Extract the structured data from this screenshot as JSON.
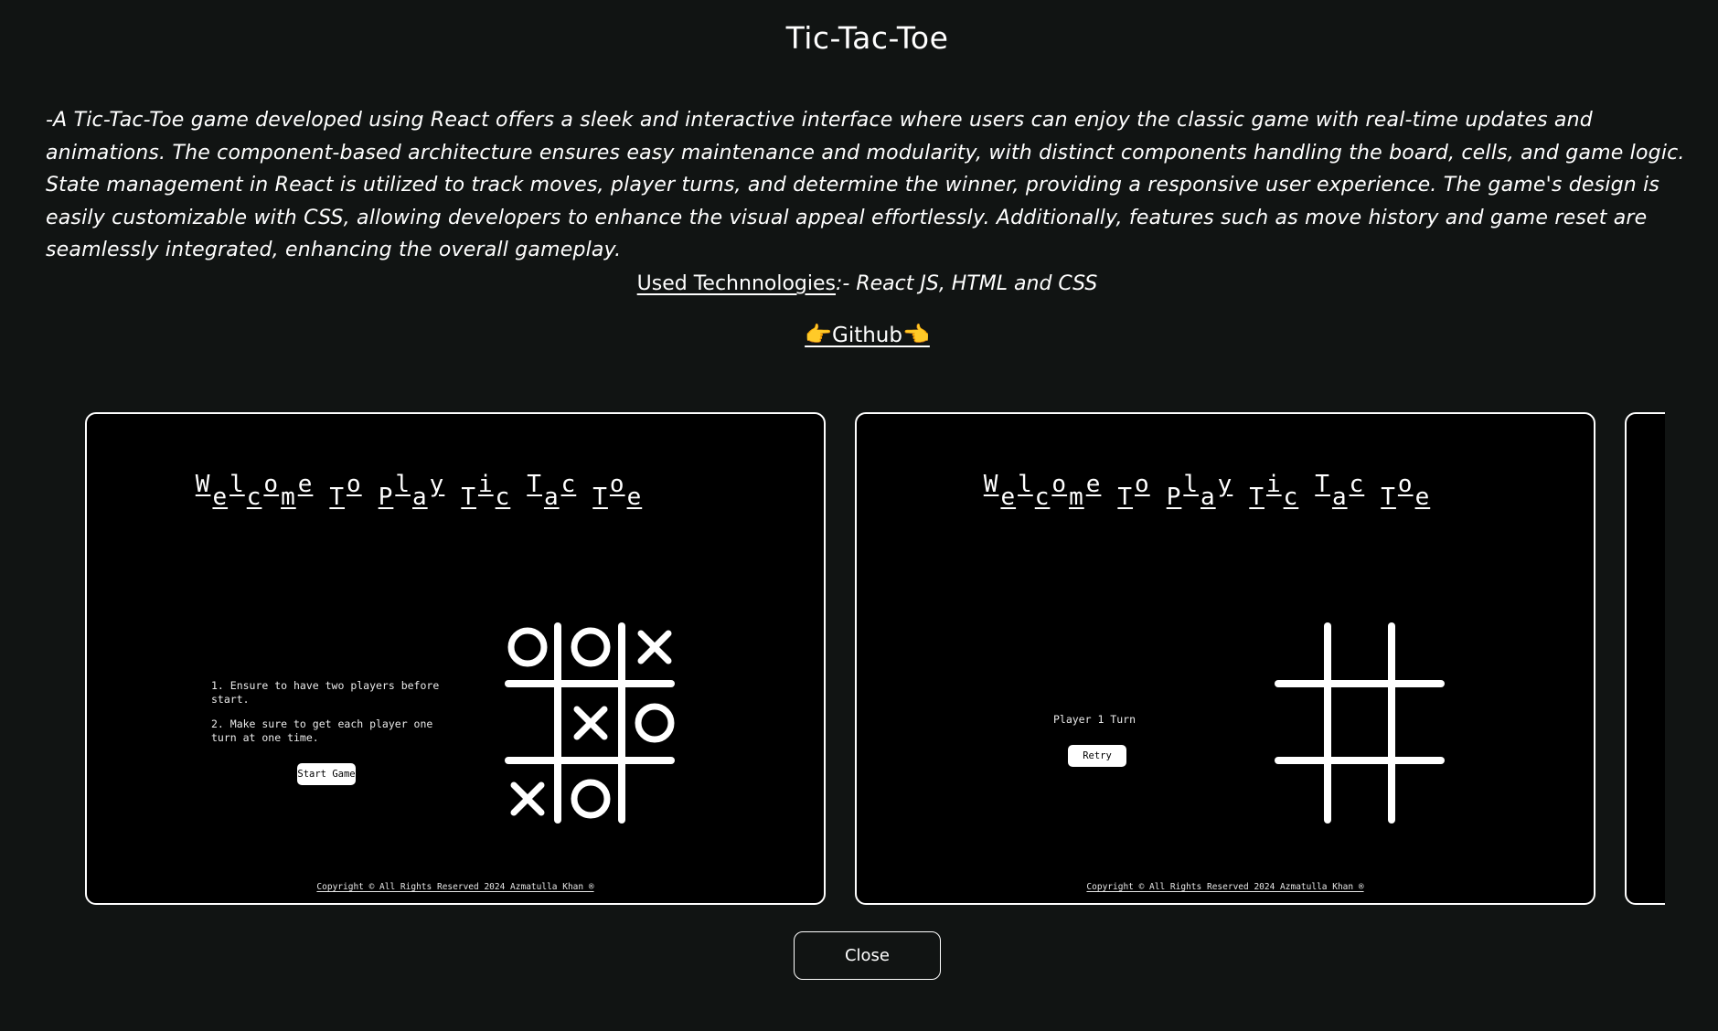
{
  "header": {
    "title": "Tic-Tac-Toe"
  },
  "description": "-A Tic-Tac-Toe game developed using React offers a sleek and interactive interface where users can enjoy the classic game with real-time updates and animations. The component-based architecture ensures easy maintenance and modularity, with distinct components handling the board, cells, and game logic. State management in React is utilized to track moves, player turns, and determine the winner, providing a responsive user experience. The game's design is easily customizable with CSS, allowing developers to enhance the visual appeal effortlessly. Additionally, features such as move history and game reset are seamlessly integrated, enhancing the overall gameplay.",
  "technologies": {
    "label": "Used Technnologies",
    "value": ":- React JS, HTML and CSS"
  },
  "github": {
    "label": "Github",
    "left_icon": "pointing-right-hand",
    "right_icon": "pointing-left-hand"
  },
  "slides": [
    {
      "welcome": "Welcome To Play Tic Tac Toe",
      "rules": [
        "1. Ensure to have two players before start.",
        "2. Make sure to get each player one turn at one time."
      ],
      "start_label": "Start Game",
      "board": [
        "O",
        "O",
        "X",
        "",
        "X",
        "O",
        "X",
        "O",
        ""
      ],
      "copyright": "Copyright © All Rights Reserved 2024 Azmatulla Khan ®"
    },
    {
      "welcome": "Welcome To Play Tic Tac Toe",
      "turn_text": "Player 1 Turn",
      "retry_label": "Retry",
      "board": [
        "",
        "",
        "",
        "",
        "",
        "",
        "",
        "",
        ""
      ],
      "copyright": "Copyright © All Rights Reserved 2024 Azmatulla Khan ®"
    }
  ],
  "close_label": "Close",
  "colors": {
    "background": "#111413",
    "slide_background": "#000000",
    "foreground": "#ffffff",
    "hand_emoji": "#f4b73a"
  }
}
